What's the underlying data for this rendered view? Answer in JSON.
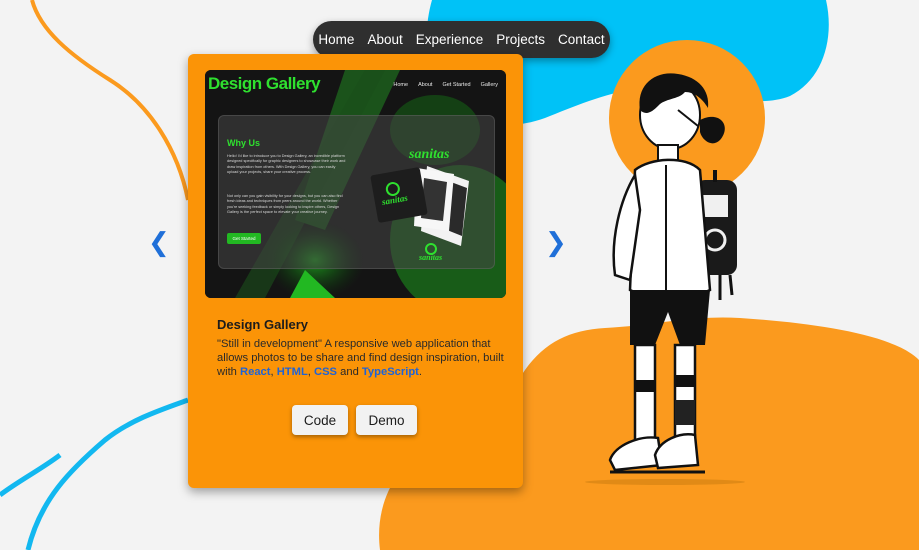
{
  "nav": {
    "items": [
      "Home",
      "About",
      "Experience",
      "Projects",
      "Contact"
    ]
  },
  "carousel": {
    "prev_icon": "chevron-left-icon",
    "next_icon": "chevron-right-icon",
    "prev_glyph": "❮",
    "next_glyph": "❯"
  },
  "project": {
    "title": "Design Gallery",
    "description_prefix": "\"Still in development\" A responsive web application that allows photos to be share and find design inspiration, built with ",
    "tech": [
      "React",
      "HTML",
      "CSS",
      "TypeScript"
    ],
    "sep1": ", ",
    "sep2": ", ",
    "sep3": " and ",
    "end": ".",
    "code_label": "Code",
    "demo_label": "Demo",
    "preview": {
      "logo": "Design Gallery",
      "nav": [
        "Home",
        "About",
        "Get Started",
        "Gallery"
      ],
      "heading": "Why Us",
      "para1": "Hello! I'd like to introduce you to Design Gallery, an incredible platform designed specifically for graphic designers to showcase their work and draw inspiration from others. With Design Gallery, you can easily upload your projects, share your creative process.",
      "para2": "Not only can you gain visibility for your designs, but you can also find fresh ideas and techniques from peers around the world. Whether you're seeking feedback or simply looking to inspire others, Design Gallery is the perfect space to elevate your creative journey.",
      "button": "Get Started",
      "art_word": "sanitas"
    }
  },
  "colors": {
    "card": "#fb9407",
    "blob_orange": "#fb9a1e",
    "blob_blue": "#00c2f7",
    "nav_bg": "#2f2f2f",
    "accent_green": "#2fe02f",
    "link_blue": "#1f63d6"
  }
}
